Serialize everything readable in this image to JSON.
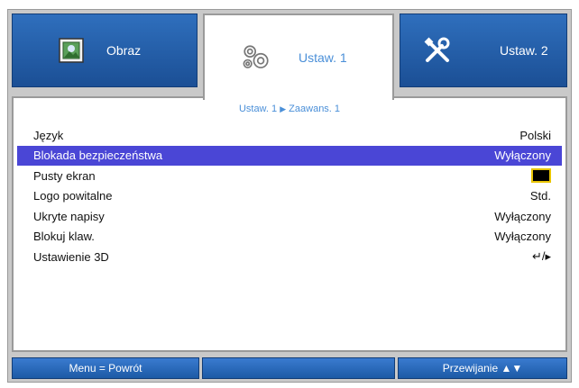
{
  "tabs": [
    {
      "label": "Obraz",
      "icon": "image-icon"
    },
    {
      "label": "Ustaw. 1",
      "icon": "gears-icon"
    },
    {
      "label": "Ustaw. 2",
      "icon": "tools-icon"
    }
  ],
  "breadcrumb": {
    "parent": "Ustaw. 1",
    "child": "Zaawans. 1",
    "separator": "▶"
  },
  "menu": [
    {
      "label": "Język",
      "value": "Polski"
    },
    {
      "label": "Blokada bezpieczeństwa",
      "value": "Wyłączony"
    },
    {
      "label": "Pusty ekran",
      "value": ""
    },
    {
      "label": "Logo powitalne",
      "value": "Std."
    },
    {
      "label": "Ukryte napisy",
      "value": "Wyłączony"
    },
    {
      "label": "Blokuj klaw.",
      "value": "Wyłączony"
    },
    {
      "label": "Ustawienie 3D",
      "value": "↵/▸"
    }
  ],
  "footer": {
    "back": "Menu = Powrót",
    "scroll": "Przewijanie ▲▼"
  },
  "colors": {
    "tab_blue": "#2f6fbd",
    "selected_row": "#4a46d6",
    "accent_text": "#4a8fd8",
    "blank_swatch_border": "#e8c400"
  }
}
